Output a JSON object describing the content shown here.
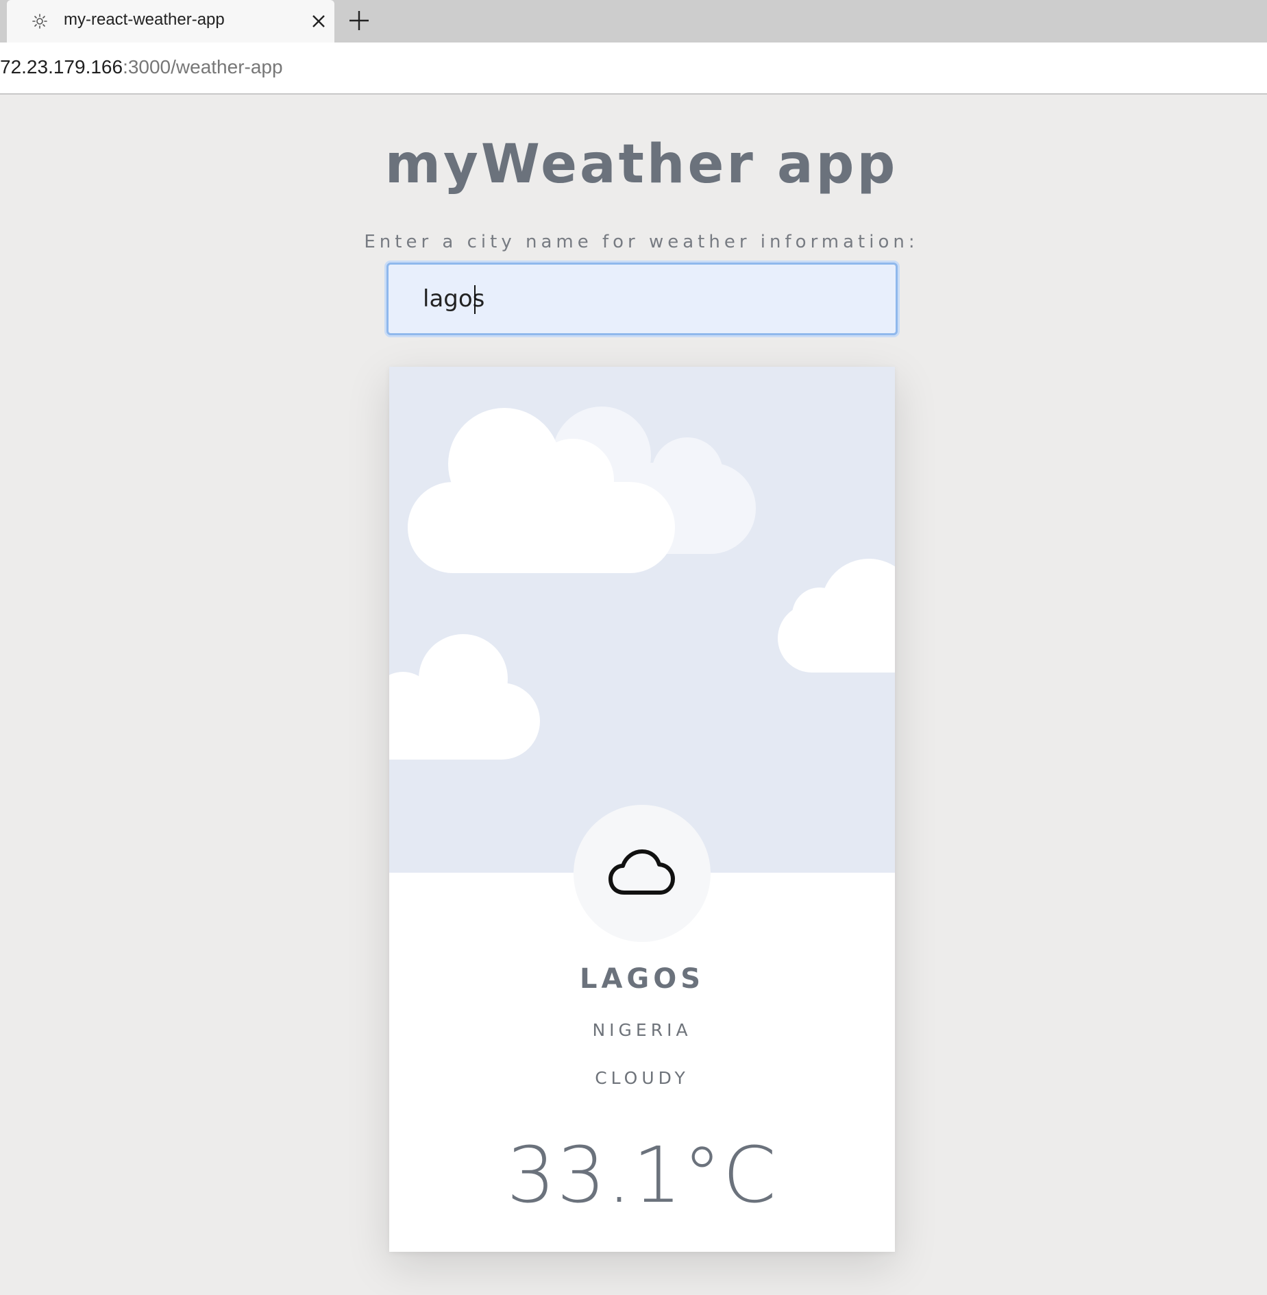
{
  "browser": {
    "tab_title": "my-react-weather-app",
    "url_host": "72.23.179.166",
    "url_path": ":3000/weather-app"
  },
  "app": {
    "title": "myWeather app",
    "prompt": "Enter a city name for weather information:",
    "search_value": "lagos"
  },
  "weather": {
    "city": "LAGOS",
    "country": "NIGERIA",
    "condition": "CLOUDY",
    "temperature": "33.1°C",
    "icon": "cloud-icon"
  },
  "colors": {
    "page_background": "#edeceb",
    "sky": "#e4e9f3",
    "text": "#6b727c",
    "input_background": "#e8effc",
    "input_border": "#8fb8ec"
  }
}
